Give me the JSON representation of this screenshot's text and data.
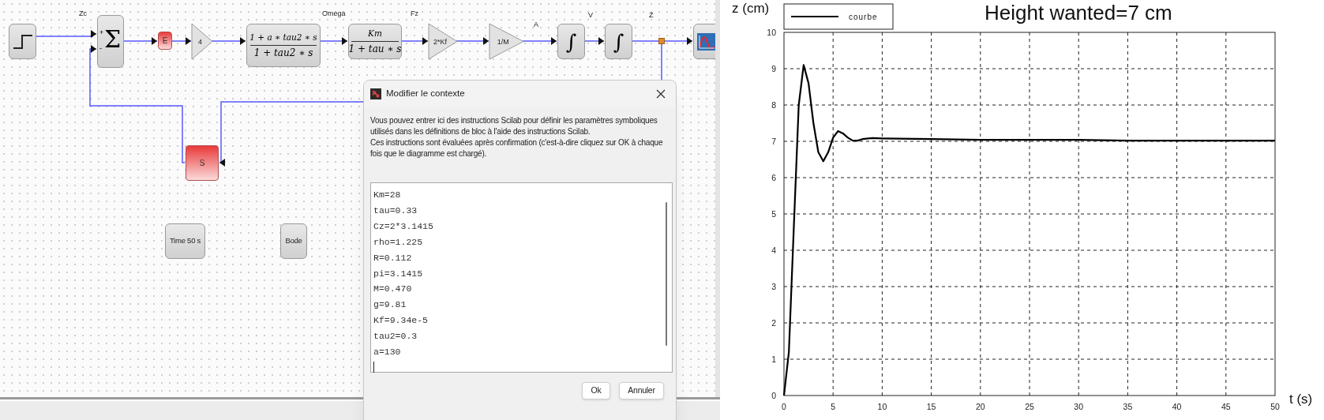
{
  "diagram": {
    "blocks": [
      {
        "kind": "step"
      },
      {
        "kind": "sum",
        "symbol": "Σ",
        "signs": [
          "+",
          "-"
        ]
      },
      {
        "kind": "red_block",
        "label": "E"
      },
      {
        "kind": "gain",
        "label": "4"
      },
      {
        "kind": "fraction",
        "numerator": "1 + a ∗ tau2 ∗ s",
        "denominator": "1 + tau2 ∗ s"
      },
      {
        "kind": "fraction",
        "numerator": "Km",
        "denominator": "1 + tau ∗ s"
      },
      {
        "kind": "gain",
        "label": "2*Kf"
      },
      {
        "kind": "gain",
        "label": "1/M"
      },
      {
        "kind": "integral",
        "symbol": "∫"
      },
      {
        "kind": "integral",
        "symbol": "∫"
      },
      {
        "kind": "split"
      },
      {
        "kind": "scope"
      },
      {
        "kind": "red_block",
        "label": "S"
      },
      {
        "kind": "text_block",
        "label": "Time 50 s"
      },
      {
        "kind": "text_block",
        "label": "Bode"
      }
    ],
    "link_labels": [
      "Zc",
      "Omega",
      "Fz",
      "A",
      "V",
      "Z"
    ]
  },
  "dialog": {
    "title": "Modifier le contexte",
    "description": [
      "Vous pouvez entrer ici des instructions Scilab pour définir les paramètres symboliques utilisés dans les définitions de bloc à l'aide des instructions Scilab.",
      "Ces instructions sont évaluées après confirmation (c'est-à-dire cliquez sur OK à chaque fois que le diagramme est chargé)."
    ],
    "context_lines": [
      "Km=28",
      "tau=0.33",
      "Cz=2*3.1415",
      "rho=1.225",
      "R=0.112",
      "pi=3.1415",
      "M=0.470",
      "g=9.81",
      "Kf=9.34e-5",
      "tau2=0.3",
      "a=130"
    ],
    "buttons": [
      "Ok",
      "Annuler"
    ]
  },
  "plot": {
    "chart_data": {
      "type": "line",
      "title": "Height wanted=7 cm",
      "xlabel": "t (s)",
      "ylabel": "z (cm)",
      "x": [
        0,
        0.5,
        1,
        1.5,
        2,
        2.5,
        3,
        3.5,
        4,
        4.5,
        5,
        5.5,
        6,
        6.5,
        7,
        7.5,
        8,
        9,
        10,
        15,
        20,
        25,
        30,
        35,
        50
      ],
      "series": [
        {
          "name": "courbe",
          "color": "#000000",
          "values": [
            0,
            1.2,
            4.6,
            8,
            9.1,
            8.6,
            7.5,
            6.7,
            6.45,
            6.7,
            7.1,
            7.28,
            7.22,
            7.1,
            7.02,
            7.02,
            7.06,
            7.09,
            7.08,
            7.06,
            7.04,
            7.04,
            7.04,
            7.02,
            7.02
          ]
        }
      ],
      "xlim": [
        0,
        50
      ],
      "ylim": [
        0,
        10
      ],
      "xticks": [
        0,
        5,
        10,
        15,
        20,
        25,
        30,
        35,
        40,
        45,
        50
      ],
      "yticks": [
        0,
        1,
        2,
        3,
        4,
        5,
        6,
        7,
        8,
        9,
        10
      ],
      "grid": true
    }
  }
}
